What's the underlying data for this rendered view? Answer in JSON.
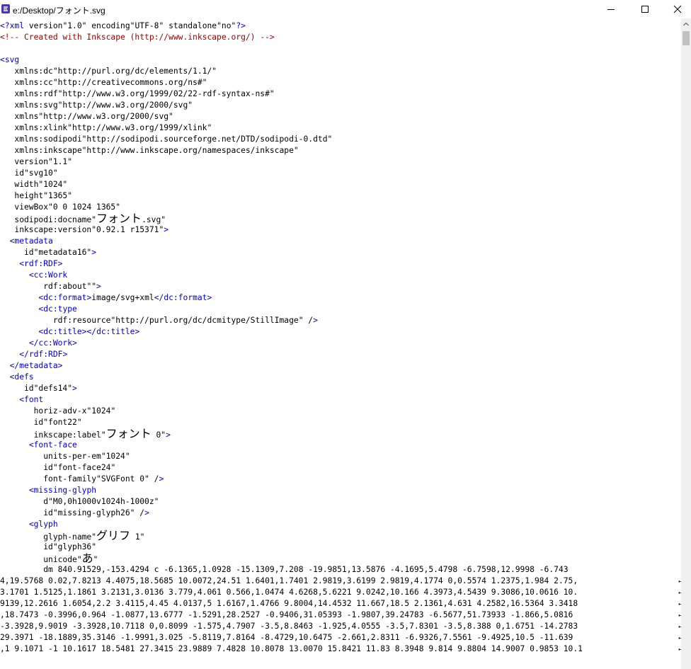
{
  "window": {
    "title": "e:/Desktop/フォント.svg",
    "icons": {
      "app": "inkscape-xml-editor-icon",
      "minimize": "minimize-icon",
      "maximize": "maximize-icon",
      "close": "close-icon"
    }
  },
  "colors": {
    "comment": "#9a0000",
    "element": "#0000c8",
    "attribute": "#7b0000",
    "text": "#000000",
    "scrollbar": "#f0f0f0",
    "thumb": "#c1c1c1"
  },
  "lines": [
    "<?xml version=\"1.0\" encoding=\"UTF-8\" standalone=\"no\"?>",
    "<!-- Created with Inkscape (http://www.inkscape.org/) -->",
    "",
    "<svg",
    "   xmlns:dc=\"http://purl.org/dc/elements/1.1/\"",
    "   xmlns:cc=\"http://creativecommons.org/ns#\"",
    "   xmlns:rdf=\"http://www.w3.org/1999/02/22-rdf-syntax-ns#\"",
    "   xmlns:svg=\"http://www.w3.org/2000/svg\"",
    "   xmlns=\"http://www.w3.org/2000/svg\"",
    "   xmlns:xlink=\"http://www.w3.org/1999/xlink\"",
    "   xmlns:sodipodi=\"http://sodipodi.sourceforge.net/DTD/sodipodi-0.dtd\"",
    "   xmlns:inkscape=\"http://www.inkscape.org/namespaces/inkscape\"",
    "   version=\"1.1\"",
    "   id=\"svg10\"",
    "   width=\"1024\"",
    "   height=\"1365\"",
    "   viewBox=\"0 0 1024 1365\"",
    "   sodipodi:docname=\"フォント.svg\"",
    "   inkscape:version=\"0.92.1 r15371\">",
    "  <metadata",
    "     id=\"metadata16\">",
    "    <rdf:RDF>",
    "      <cc:Work",
    "         rdf:about=\"\">",
    "        <dc:format>image/svg+xml</dc:format>",
    "        <dc:type",
    "           rdf:resource=\"http://purl.org/dc/dcmitype/StillImage\" />",
    "        <dc:title></dc:title>",
    "      </cc:Work>",
    "    </rdf:RDF>",
    "  </metadata>",
    "  <defs",
    "     id=\"defs14\">",
    "    <font",
    "       horiz-adv-x=\"1024\"",
    "       id=\"font22\"",
    "       inkscape:label=\"フォント 0\">",
    "      <font-face",
    "         units-per-em=\"1024\"",
    "         id=\"font-face24\"",
    "         font-family=\"SVGFont 0\" />",
    "      <missing-glyph",
    "         d=\"M0,0h1000v1024h-1000z\"",
    "         id=\"missing-glyph26\" />",
    "      <glyph",
    "         glyph-name=\"グリフ 1\"",
    "         id=\"glyph36\"",
    "         unicode=\"あ\"",
    "         d=\"m 840.91529,-153.4294 c -6.1365,1.0928 -15.1309,7.208 -19.9851,13.5876 -4.1695,5.4798 -6.7598,12.9998 -6.743",
    "4,19.5768 0.02,7.8213 4.4075,18.5685 10.0072,24.51 1.6401,1.7401 2.9819,3.6199 2.9819,4.1774 0,0.5574 1.2375,1.984 2.75,",
    "3.1701 1.5125,1.1861 3.2131,3.0136 3.779,4.061 0.566,1.0474 4.6268,5.6221 9.0242,10.166 4.3973,4.5439 9.3086,10.0616 10.",
    "9139,12.2616 1.6054,2.2 3.4115,4.45 4.0137,5 1.6167,1.4766 9.8004,14.4532 11.667,18.5 2.1361,4.631 4.2582,16.5364 3.3418",
    ",18.7473 -0.3996,0.964 -1.0877,13.6777 -1.5291,28.2527 -0.9406,31.05393 -1.9807,39.24783 -6.5677,51.73933 -1.866,5.0816",
    "-3.3928,9.9019 -3.3928,10.7118 0,0.8099 -1.575,4.7907 -3.5,8.8463 -1.925,4.0555 -3.5,7.8301 -3.5,8.388 0,1.6751 -14.2783",
    "29.3971 -18.1889,35.3146 -1.9991,3.025 -5.8119,7.8164 -8.4729,10.6475 -2.661,2.8311 -6.9326,7.5561 -9.4925,10.5 -11.639",
    ",1 9.1071 -1 10.1617 18.5481 27.3415 23.9889 7.4828 10.8078 13.0070 15.8421 11.83 8.3948 9.814 9.8804 14.9007 0.9853 10.1"
  ]
}
